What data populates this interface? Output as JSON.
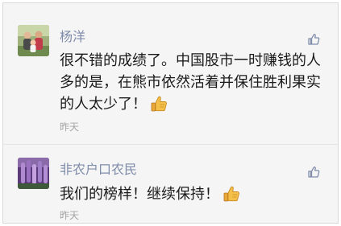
{
  "comments": [
    {
      "author": "杨洋",
      "text": "很不错的成绩了。中国股市一时赚钱的人多的是，在熊市依然活着并保住胜利果实的人太少了！",
      "time": "昨天",
      "avatar_icon": "family-photo-avatar",
      "like_icon": "thumbs-up-outline-icon",
      "emoji": "thumbs-up-emoji"
    },
    {
      "author": "非农户口农民",
      "text": "我们的榜样！继续保持！",
      "time": "昨天",
      "avatar_icon": "purple-flowers-avatar",
      "like_icon": "thumbs-up-outline-icon",
      "emoji": "thumbs-up-emoji"
    }
  ],
  "colors": {
    "author_name": "#7f8caa",
    "body_text": "#1a1a1a",
    "timestamp": "#a3a3a3",
    "background": "#f5f5f5",
    "like_icon": "#7f8caa",
    "emoji_yellow": "#f5c04a"
  }
}
